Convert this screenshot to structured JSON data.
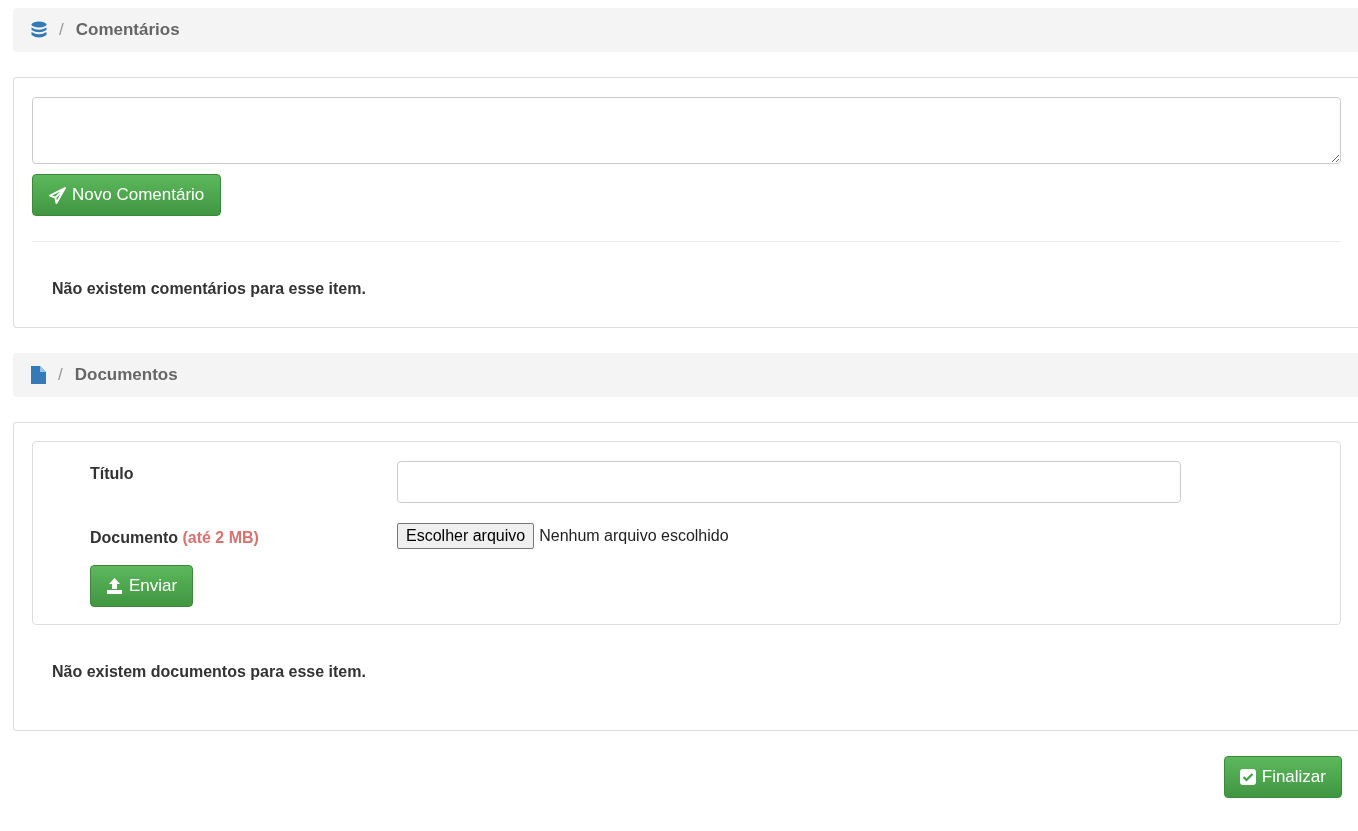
{
  "comments": {
    "breadcrumb": {
      "separator": "/",
      "title": "Comentários"
    },
    "submit_button": "Novo Comentário",
    "empty_message": "Não existem comentários para esse item."
  },
  "documents": {
    "breadcrumb": {
      "separator": "/",
      "title": "Documentos"
    },
    "title_field": {
      "label": "Título"
    },
    "document_field": {
      "label": "Documento",
      "hint": "(até 2 MB)",
      "choose_button": "Escolher arquivo",
      "status": "Nenhum arquivo escolhido"
    },
    "upload_button": "Enviar",
    "empty_message": "Não existem documentos para esse item."
  },
  "finish_button": "Finalizar"
}
